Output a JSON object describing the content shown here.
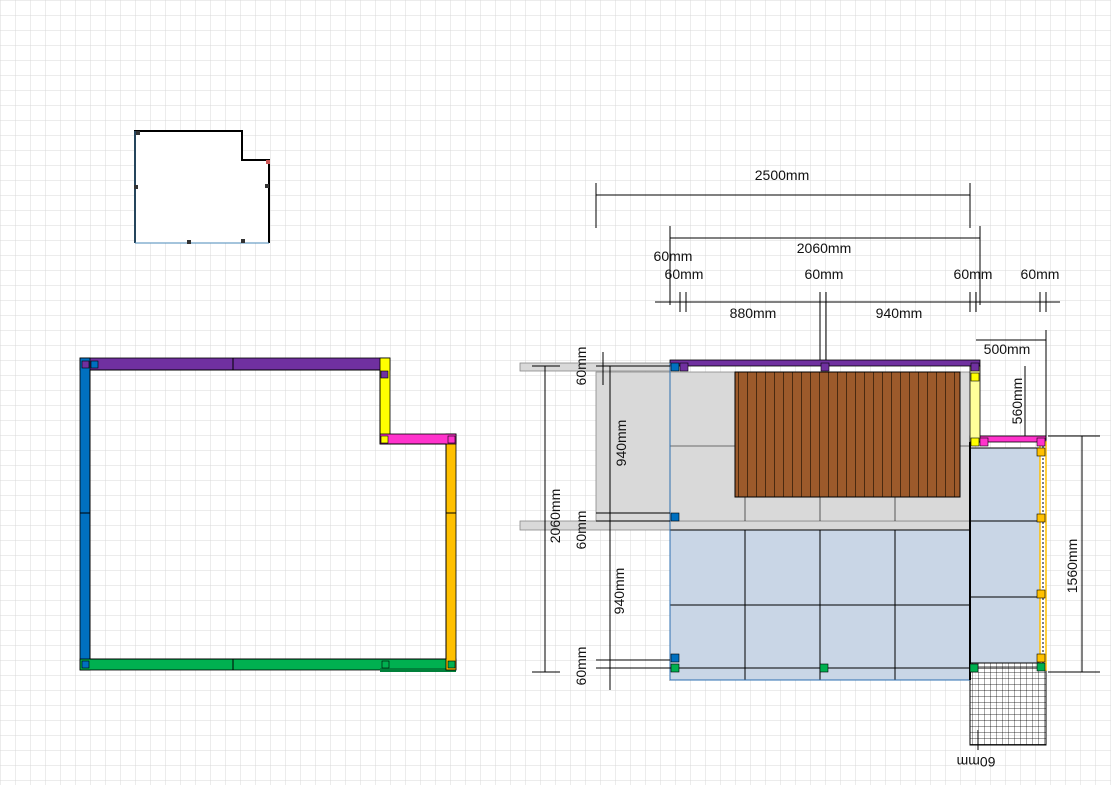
{
  "colors": {
    "grid": "#d9d9d9",
    "paper": "#ffffff",
    "wall_top": "#7030a0",
    "wall_left": "#0070c0",
    "wall_bottom": "#00b050",
    "wall_right": "#ffc000",
    "wall_step_vertical": "#ffff00",
    "wall_step_horizontal": "#ff33cc",
    "floor_panel": "#c9d6e6",
    "slab_gray": "#d9d9d9",
    "decking": "#9c5a2b",
    "dim_line": "#000000"
  },
  "dimensions": {
    "top_width": "2500mm",
    "inner_width": "2060mm",
    "post_a": "60mm",
    "post_b": "60mm",
    "post_c": "60mm",
    "post_d": "60mm",
    "post_e": "60mm",
    "span_left": "880mm",
    "span_right": "940mm",
    "step_width": "500mm",
    "step_depth": "560mm",
    "left_top_post": "60mm",
    "left_upper_span": "940mm",
    "left_total": "2060mm",
    "left_mid_post": "60mm",
    "left_lower_span": "940mm",
    "left_bottom_post": "60mm",
    "right_height": "1560mm",
    "bottom_flipped": "60mm"
  }
}
